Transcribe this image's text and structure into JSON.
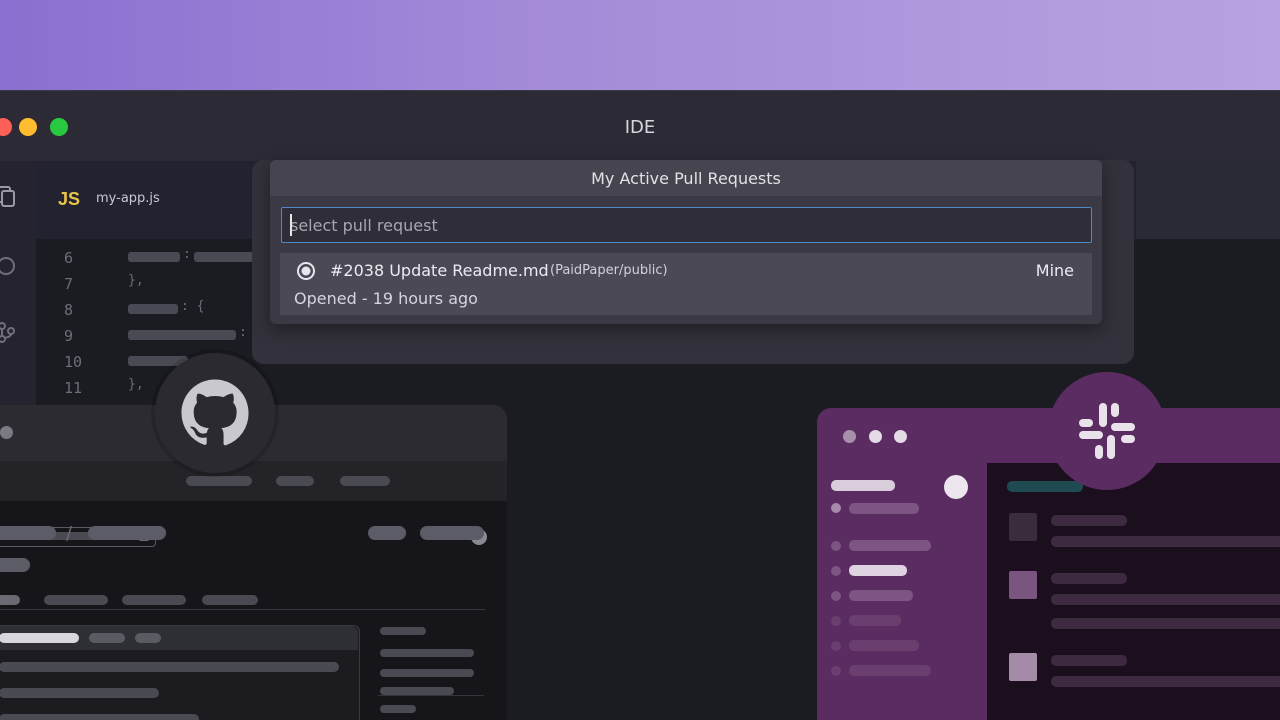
{
  "window": {
    "title": "IDE"
  },
  "editor": {
    "tab": {
      "language_badge": "JS",
      "filename": "my-app.js"
    },
    "line_numbers": [
      "6",
      "7",
      "8",
      "9",
      "10",
      "11"
    ],
    "code_fragments": [
      ":",
      "},",
      ": {",
      ":",
      "},"
    ]
  },
  "quick_pick": {
    "title": "My Active Pull Requests",
    "input": {
      "value": "",
      "placeholder": "select pull request"
    },
    "items": [
      {
        "title": "#2038 Update Readme.md",
        "repo": "(PaidPaper/public)",
        "tag": "Mine",
        "detail": "Opened - 19 hours ago",
        "icon": "pull-request-icon"
      }
    ]
  },
  "icons": {
    "activity": [
      "files-icon",
      "search-icon",
      "source-control-icon"
    ],
    "badges": [
      "github-icon",
      "slack-icon"
    ]
  },
  "colors": {
    "accent_focus": "#4d88c9",
    "js_badge": "#e8c547",
    "slack_purple": "#5b2c61",
    "traffic_red": "#fe5f57",
    "traffic_yellow": "#febc2e",
    "traffic_green": "#28c840"
  }
}
